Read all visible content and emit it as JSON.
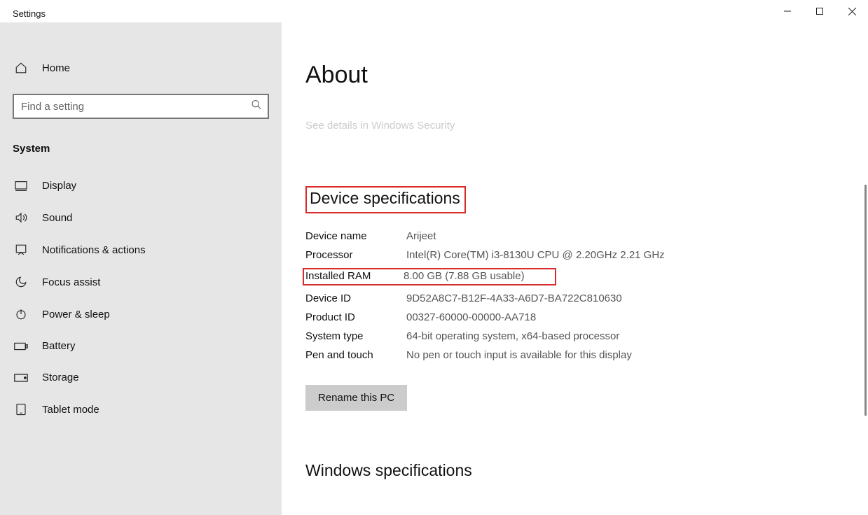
{
  "titlebar": {
    "app": "Settings"
  },
  "sidebar": {
    "home": "Home",
    "searchPlaceholder": "Find a setting",
    "category": "System",
    "items": [
      {
        "label": "Display"
      },
      {
        "label": "Sound"
      },
      {
        "label": "Notifications & actions"
      },
      {
        "label": "Focus assist"
      },
      {
        "label": "Power & sleep"
      },
      {
        "label": "Battery"
      },
      {
        "label": "Storage"
      },
      {
        "label": "Tablet mode"
      }
    ]
  },
  "content": {
    "title": "About",
    "subtext": "See details in Windows Security",
    "deviceSpecsHeading": "Device specifications",
    "specs": {
      "deviceNameLabel": "Device name",
      "deviceName": "Arijeet",
      "processorLabel": "Processor",
      "processor": "Intel(R) Core(TM) i3-8130U CPU @ 2.20GHz   2.21 GHz",
      "ramLabel": "Installed RAM",
      "ram": "8.00 GB (7.88 GB usable)",
      "deviceIdLabel": "Device ID",
      "deviceId": "9D52A8C7-B12F-4A33-A6D7-BA722C810630",
      "productIdLabel": "Product ID",
      "productId": "00327-60000-00000-AA718",
      "systemTypeLabel": "System type",
      "systemType": "64-bit operating system, x64-based processor",
      "penTouchLabel": "Pen and touch",
      "penTouch": "No pen or touch input is available for this display"
    },
    "renameBtn": "Rename this PC",
    "winSpecsHeading": "Windows specifications"
  }
}
